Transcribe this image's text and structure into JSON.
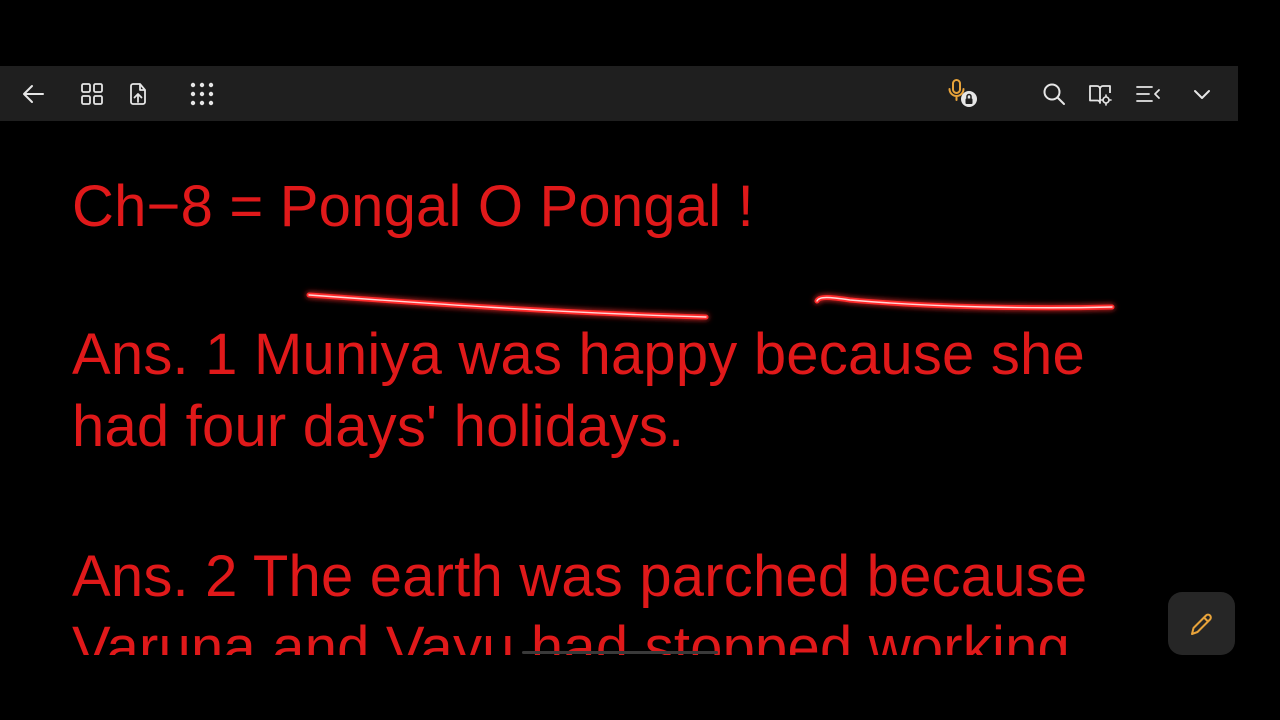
{
  "toolbar": {
    "left_icons": [
      "back-arrow-icon",
      "grid-view-icon",
      "export-icon",
      "apps-menu-icon"
    ],
    "right_icons": [
      "voice-recording-locked-icon",
      "search-icon",
      "reading-mode-settings-icon",
      "text-menu-icon",
      "chevron-down-icon"
    ],
    "accent_color": "#e8a33a"
  },
  "note": {
    "text_color": "#e0191a",
    "lines": [
      "Ch−8 = Pongal O Pongal !",
      "Ans. 1 Muniya was happy because she",
      "had four days'  holidays.",
      "Ans. 2 The earth was parched because",
      "Varuna and Vayu had stopped working"
    ],
    "underline_color": "#ff3b3b"
  },
  "fab": {
    "icon": "pen-edit-icon",
    "color": "#e8a33a"
  }
}
